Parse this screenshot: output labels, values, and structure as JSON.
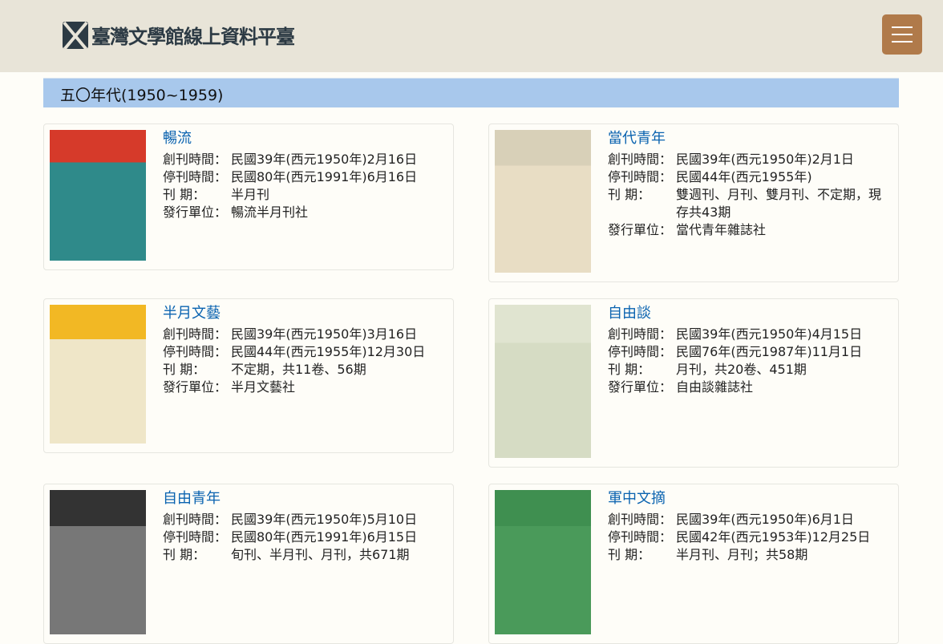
{
  "header": {
    "logo_text": "臺灣文學館線上資料平臺",
    "menu_label": "menu"
  },
  "section": {
    "title": "五〇年代(1950~1959)"
  },
  "labels": {
    "start": "創刊時間：",
    "end": "停刊時間：",
    "freq": "刊 期：",
    "publisher": "發行單位："
  },
  "items": [
    {
      "title": "暢流",
      "start": "民國39年(西元1950年)2月16日",
      "end": "民國80年(西元1991年)6月16日",
      "freq": "半月刊",
      "publisher": "暢流半月刊社",
      "cover_color": "#2f8a8a",
      "cover_top": "#d63a2a"
    },
    {
      "title": "當代青年",
      "start": "民國39年(西元1950年)2月1日",
      "end": "民國44年(西元1955年)",
      "freq": "雙週刊、月刊、雙月刊、不定期，現存共43期",
      "publisher": "當代青年雜誌社",
      "cover_color": "#e8ddc4",
      "cover_top": "#d8d0b8"
    },
    {
      "title": "半月文藝",
      "start": "民國39年(西元1950年)3月16日",
      "end": "民國44年(西元1955年)12月30日",
      "freq": "不定期，共11卷、56期",
      "publisher": "半月文藝社",
      "cover_color": "#efe6c8",
      "cover_top": "#f2b824"
    },
    {
      "title": "自由談",
      "start": "民國39年(西元1950年)4月15日",
      "end": "民國76年(西元1987年)11月1日",
      "freq": "月刊，共20卷、451期",
      "publisher": "自由談雜誌社",
      "cover_color": "#d6dcc4",
      "cover_top": "#e0e4d0"
    },
    {
      "title": "自由青年",
      "start": "民國39年(西元1950年)5月10日",
      "end": "民國80年(西元1991年)6月15日",
      "freq": "旬刊、半月刊、月刊，共671期",
      "publisher": "",
      "cover_color": "#777",
      "cover_top": "#333"
    },
    {
      "title": "軍中文摘",
      "start": "民國39年(西元1950年)6月1日",
      "end": "民國42年(西元1953年)12月25日",
      "freq": "半月刊、月刊；共58期",
      "publisher": "",
      "cover_color": "#4a9a5a",
      "cover_top": "#3f8f50"
    }
  ]
}
